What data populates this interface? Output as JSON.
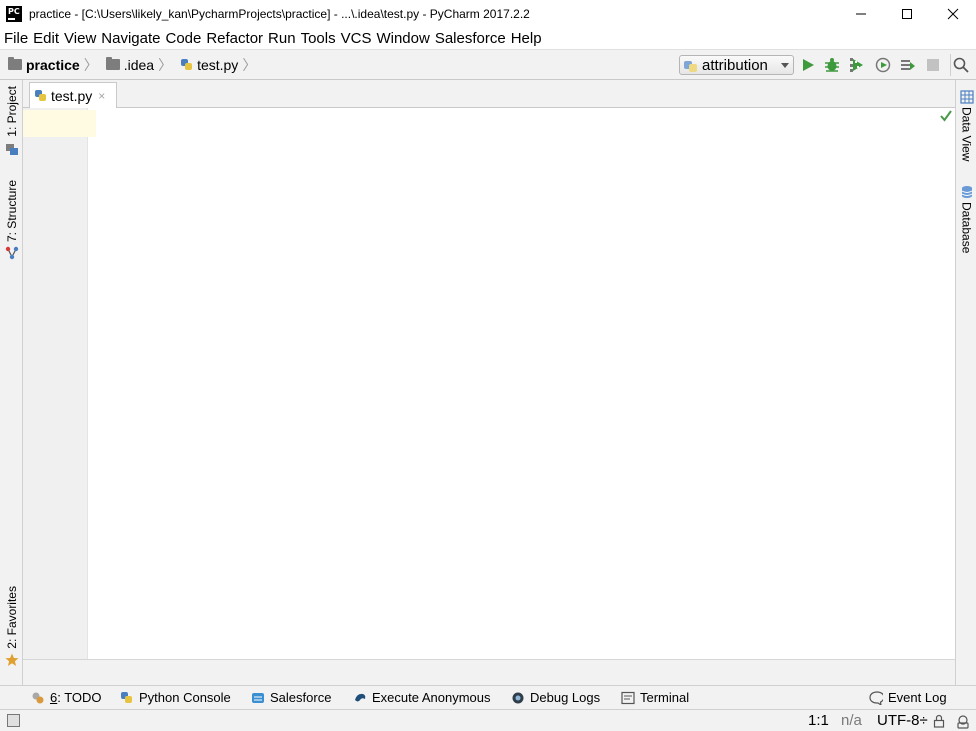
{
  "window": {
    "title": "practice - [C:\\Users\\likely_kan\\PycharmProjects\\practice] - ...\\.idea\\test.py - PyCharm 2017.2.2",
    "app_icon_text": "PC"
  },
  "menu": [
    "File",
    "Edit",
    "View",
    "Navigate",
    "Code",
    "Refactor",
    "Run",
    "Tools",
    "VCS",
    "Window",
    "Salesforce",
    "Help"
  ],
  "breadcrumb": {
    "project": "practice",
    "folder": ".idea",
    "file": "test.py"
  },
  "toolbar": {
    "run_config": "attribution"
  },
  "left_tools": {
    "project": "1: Project",
    "structure": "7: Structure",
    "favorites": "2: Favorites"
  },
  "right_tools": {
    "data_view": "Data View",
    "database": "Database"
  },
  "editor": {
    "tab_label": "test.py",
    "tab_close": "×"
  },
  "bottom_tools": {
    "todo_num": "6",
    "todo_label": ": TODO",
    "python_console": "Python Console",
    "salesforce": "Salesforce",
    "execute_anonymous": "Execute Anonymous",
    "debug_logs": "Debug Logs",
    "terminal": "Terminal",
    "event_log": "Event Log"
  },
  "status": {
    "position": "1:1",
    "line_sep": "n/a",
    "encoding": "UTF-8÷"
  },
  "colors": {
    "run_green": "#3d9a3d",
    "current_line": "#fffbe3",
    "check_green": "#4a9a4a"
  }
}
